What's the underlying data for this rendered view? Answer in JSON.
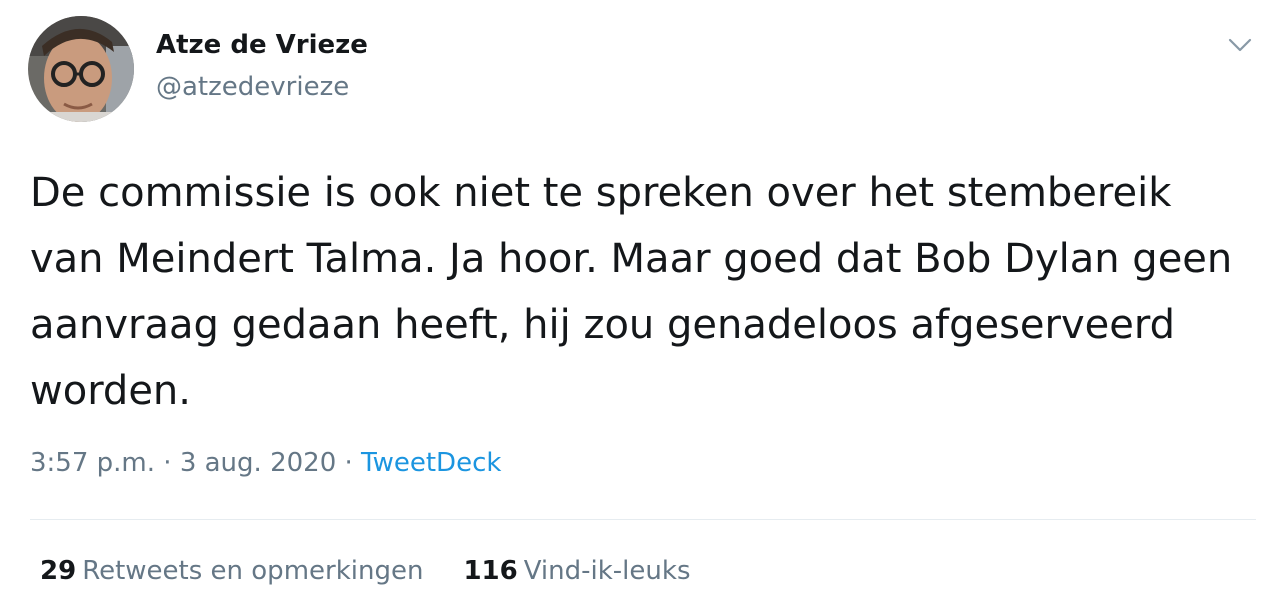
{
  "author": {
    "display_name": "Atze de Vrieze",
    "handle": "@atzedevrieze",
    "avatar_icon": "profile-photo"
  },
  "tweet": {
    "text": "De commissie is ook niet te spreken over het stembereik van Meindert Talma. Ja hoor. Maar goed dat Bob Dylan geen aanvraag gedaan heeft, hij zou genadeloos afgeserveerd worden."
  },
  "meta": {
    "time": "3:57 p.m.",
    "separator": " · ",
    "date": "3 aug. 2020",
    "source": "TweetDeck"
  },
  "stats": {
    "retweets_count": "29",
    "retweets_label": "Retweets en opmerkingen",
    "likes_count": "116",
    "likes_label": "Vind-ik-leuks"
  },
  "colors": {
    "text": "#14171a",
    "secondary": "#657786",
    "link": "#1b95e0",
    "divider": "#e6ecf0"
  },
  "icons": {
    "menu": "chevron-down-icon"
  }
}
